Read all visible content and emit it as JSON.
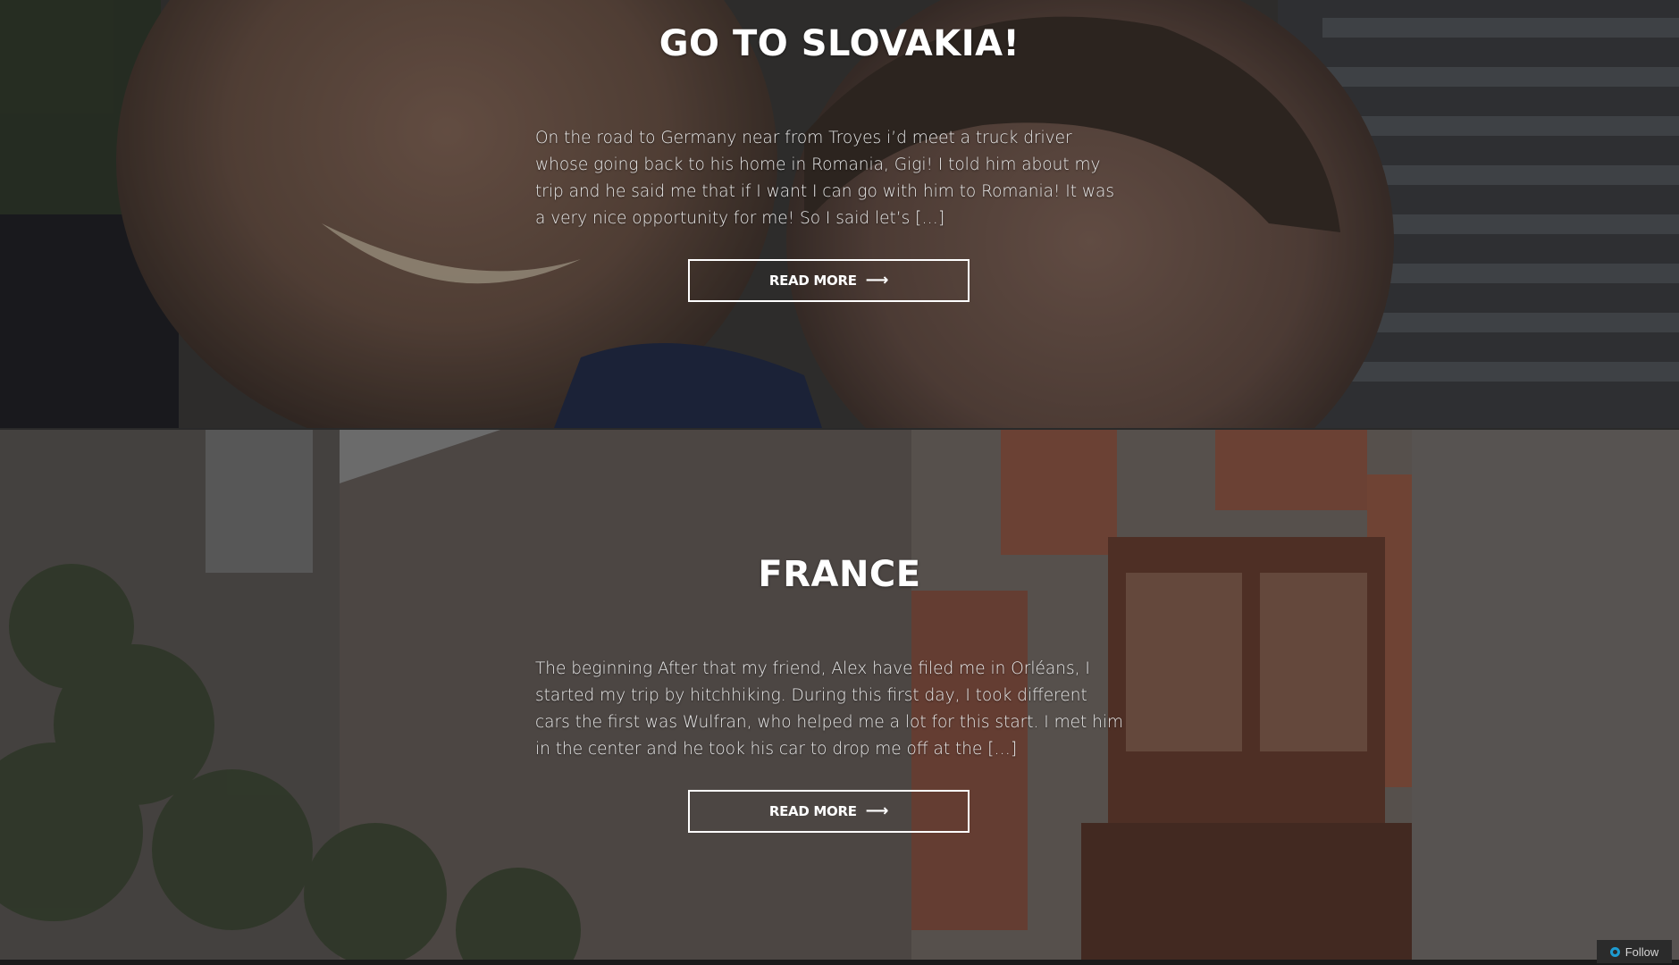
{
  "posts": [
    {
      "title": "GO TO SLOVAKIA!",
      "excerpt": "On the road to Germany near from Troyes i’d meet a truck driver whose going back to his home in Romania, Gigi! I told him about my trip and he said me that if I want I can go with him to Romania! It was a very nice opportunity for me! So I said let’s […]",
      "button_label": "READ MORE",
      "button_arrow": "⟶"
    },
    {
      "title": "FRANCE",
      "excerpt": "The beginning After that my friend, Alex have filed me in Orléans, I started my trip by hitchhiking. During this first day, I took different cars the first was Wulfran, who helped me a lot for this start. I met him in the center and he took his car to drop me off at the […]",
      "button_label": "READ MORE",
      "button_arrow": "⟶"
    }
  ],
  "follow": {
    "label": "Follow",
    "icon": "follow-icon"
  }
}
